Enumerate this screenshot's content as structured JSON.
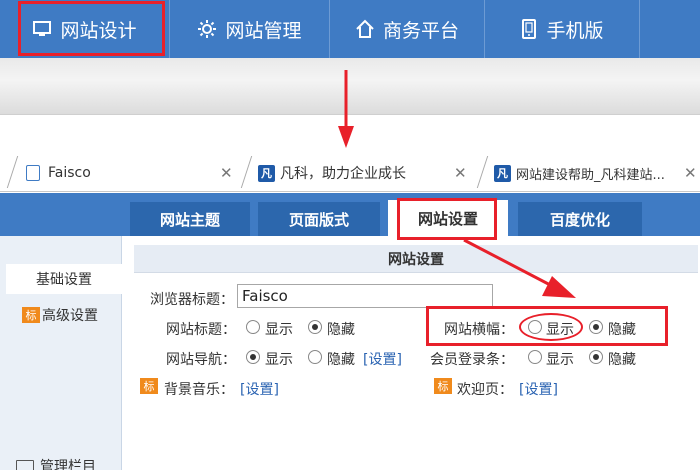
{
  "top_nav": {
    "items": [
      {
        "label": "网站设计",
        "icon": "monitor-icon"
      },
      {
        "label": "网站管理",
        "icon": "gear-icon"
      },
      {
        "label": "商务平台",
        "icon": "home-icon"
      },
      {
        "label": "手机版",
        "icon": "phone-icon"
      }
    ]
  },
  "browser_tabs": [
    {
      "title": "Faisco"
    },
    {
      "title": "凡科，助力企业成长"
    },
    {
      "title": "网站建设帮助_凡科建站..."
    }
  ],
  "favicon_letter": "凡",
  "app_tabs": [
    {
      "label": "网站主题"
    },
    {
      "label": "页面版式"
    },
    {
      "label": "网站设置"
    },
    {
      "label": "百度优化"
    }
  ],
  "sidebar": {
    "items": [
      {
        "label": "基础设置"
      },
      {
        "label": "高级设置",
        "badge": "标"
      },
      {
        "label": "管理栏目"
      }
    ]
  },
  "panel": {
    "title": "网站设置",
    "browser_title_label": "浏览器标题：",
    "browser_title_value": "Faisco",
    "site_title_label": "网站标题：",
    "site_nav_label": "网站导航：",
    "bg_music_label": "背景音乐：",
    "banner_label": "网站横幅：",
    "member_bar_label": "会员登录条：",
    "welcome_label": "欢迎页：",
    "show": "显示",
    "hide": "隐藏",
    "settings_link": "[设置]",
    "badge": "标"
  },
  "colors": {
    "nav_blue": "#3f7bc4",
    "annotation_red": "#e8202a",
    "badge_orange": "#f08a1c",
    "link_blue": "#2a63b2"
  }
}
